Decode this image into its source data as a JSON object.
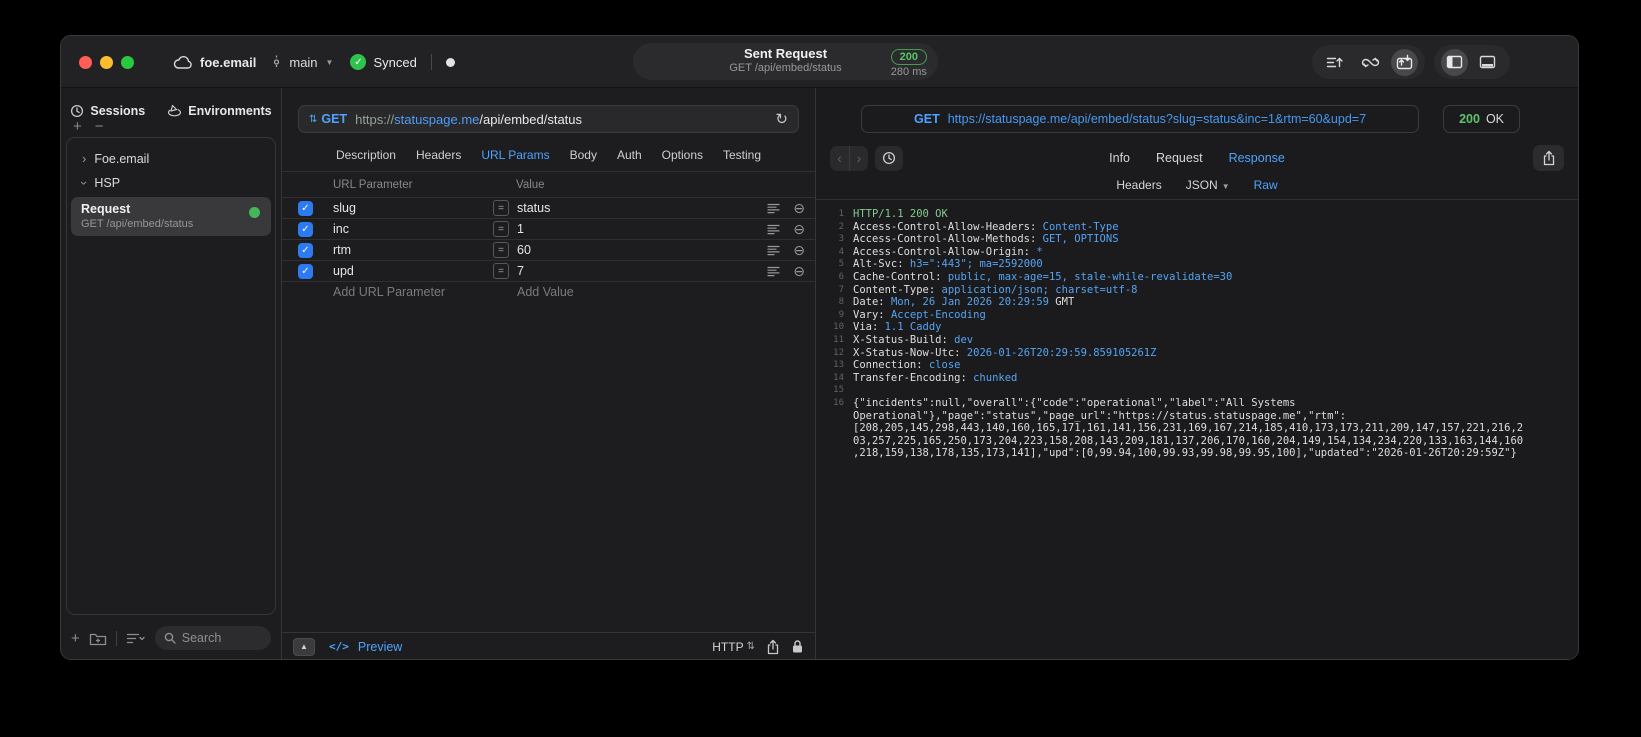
{
  "titlebar": {
    "project": "foe.email",
    "branch": "main",
    "sync_status": "Synced",
    "request_pill": {
      "title": "Sent Request",
      "subtitle": "GET /api/embed/status",
      "status": "200",
      "duration": "280 ms"
    }
  },
  "sidebar": {
    "tabs": {
      "sessions": "Sessions",
      "environments": "Environments"
    },
    "tree": [
      {
        "label": "Foe.email"
      },
      {
        "label": "HSP"
      }
    ],
    "request_item": {
      "title": "Request",
      "subtitle": "GET /api/embed/status"
    },
    "search_placeholder": "Search"
  },
  "request_editor": {
    "method": "GET",
    "url_scheme": "https://",
    "url_host": "statuspage.me",
    "url_path": "/api/embed/status",
    "tabs": [
      {
        "label": "Description"
      },
      {
        "label": "Headers"
      },
      {
        "label": "URL Params",
        "active": true
      },
      {
        "label": "Body"
      },
      {
        "label": "Auth"
      },
      {
        "label": "Options"
      },
      {
        "label": "Testing"
      }
    ],
    "params": {
      "col_name": "URL Parameter",
      "col_value": "Value",
      "rows": [
        {
          "name": "slug",
          "value": "status"
        },
        {
          "name": "inc",
          "value": "1"
        },
        {
          "name": "rtm",
          "value": "60"
        },
        {
          "name": "upd",
          "value": "7"
        }
      ],
      "add_name": "Add URL Parameter",
      "add_value": "Add Value"
    },
    "footer": {
      "code_glyph": "</>",
      "preview": "Preview",
      "protocol": "HTTP"
    }
  },
  "response_viewer": {
    "method": "GET",
    "url": "https://statuspage.me/api/embed/status?slug=status&inc=1&rtm=60&upd=7",
    "status_code": "200",
    "status_text": "OK",
    "tabs": [
      {
        "label": "Info"
      },
      {
        "label": "Request"
      },
      {
        "label": "Response",
        "active": true
      }
    ],
    "subtabs": [
      {
        "label": "Headers"
      },
      {
        "label": "JSON",
        "chevron": true
      },
      {
        "label": "Raw",
        "active": true
      }
    ],
    "lines": [
      {
        "num": "1",
        "green": "HTTP/1.1 200 OK"
      },
      {
        "num": "2",
        "white": "Access-Control-Allow-Headers: ",
        "blue": "Content-Type"
      },
      {
        "num": "3",
        "white": "Access-Control-Allow-Methods: ",
        "blue": "GET, OPTIONS"
      },
      {
        "num": "4",
        "white": "Access-Control-Allow-Origin: ",
        "blue": "*"
      },
      {
        "num": "5",
        "white": "Alt-Svc: ",
        "blue": "h3=\":443\"; ma=2592000"
      },
      {
        "num": "6",
        "white": "Cache-Control: ",
        "blue": "public, max-age=15, stale-while-revalidate=30"
      },
      {
        "num": "7",
        "white": "Content-Type: ",
        "blue": "application/json; charset=utf-8"
      },
      {
        "num": "8",
        "white": "Date: ",
        "blue": "Mon, 26 Jan 2026 20:29:59",
        "white2": " GMT"
      },
      {
        "num": "9",
        "white": "Vary: ",
        "blue": "Accept-Encoding"
      },
      {
        "num": "10",
        "white": "Via: ",
        "blue": "1.1 Caddy"
      },
      {
        "num": "11",
        "white": "X-Status-Build: ",
        "blue": "dev"
      },
      {
        "num": "12",
        "white": "X-Status-Now-Utc: ",
        "blue": "2026-01-26T20:29:59.859105261Z"
      },
      {
        "num": "13",
        "white": "Connection: ",
        "blue": "close"
      },
      {
        "num": "14",
        "white": "Transfer-Encoding: ",
        "blue": "chunked"
      },
      {
        "num": "15"
      },
      {
        "num": "16",
        "white": "{\"incidents\":null,\"overall\":{\"code\":\"operational\",\"label\":\"All Systems Operational\"},\"page\":\"status\",\"page_url\":\"https://status.statuspage.me\",\"rtm\":[208,205,145,298,443,140,160,165,171,161,141,156,231,169,167,214,185,410,173,173,211,209,147,157,221,216,203,257,225,165,250,173,204,223,158,208,143,209,181,137,206,170,160,204,149,154,134,234,220,133,163,144,160,218,159,138,178,135,173,141],\"upd\":[0,99.94,100,99.93,99.98,99.95,100],\"updated\":\"2026-01-26T20:29:59Z\"}"
      }
    ]
  }
}
